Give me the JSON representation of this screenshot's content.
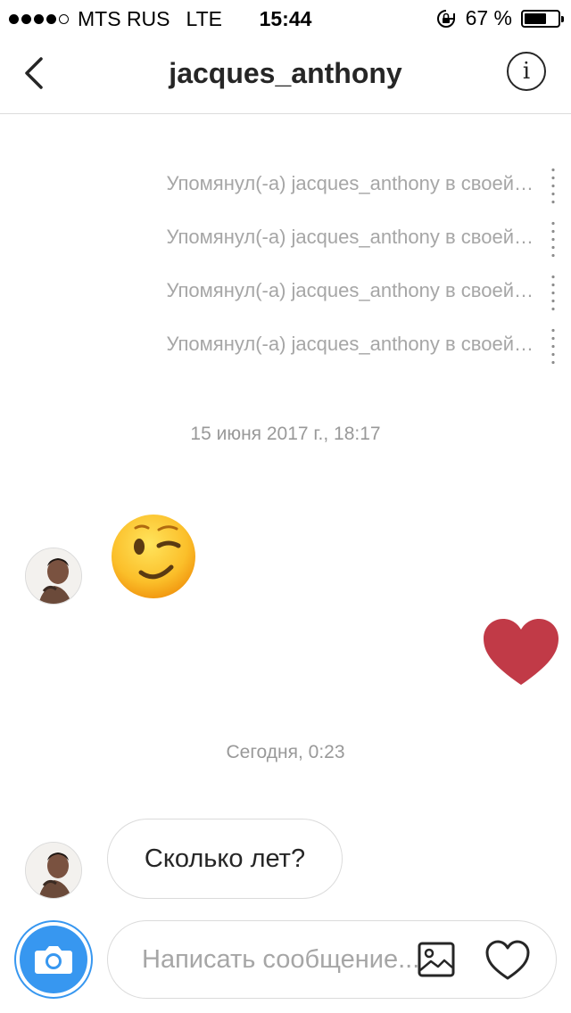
{
  "status_bar": {
    "carrier": "MTS RUS",
    "network": "LTE",
    "time": "15:44",
    "battery_percent": "67 %",
    "battery_level": 0.67,
    "signal_strength": "4 of 5"
  },
  "header": {
    "title": "jacques_anthony",
    "back_icon": "chevron-left-icon",
    "info_icon": "info-icon"
  },
  "messages": {
    "mentions": [
      "Упомянул(-а) jacques_anthony в своей…",
      "Упомянул(-а) jacques_anthony в своей…",
      "Упомянул(-а) jacques_anthony в своей…",
      "Упомянул(-а) jacques_anthony в своей…"
    ],
    "timestamp_1": "15 июня 2017 г., 18:17",
    "incoming_emoji": "winking-face",
    "outgoing_heart": "heart",
    "heart_color": "#c13a47",
    "timestamp_2": "Сегодня, 0:23",
    "incoming_text": "Сколько лет?"
  },
  "composer": {
    "placeholder": "Написать сообщение...",
    "camera_icon": "camera-icon",
    "gallery_icon": "gallery-icon",
    "like_icon": "heart-outline-icon",
    "accent_color": "#3797f0"
  }
}
